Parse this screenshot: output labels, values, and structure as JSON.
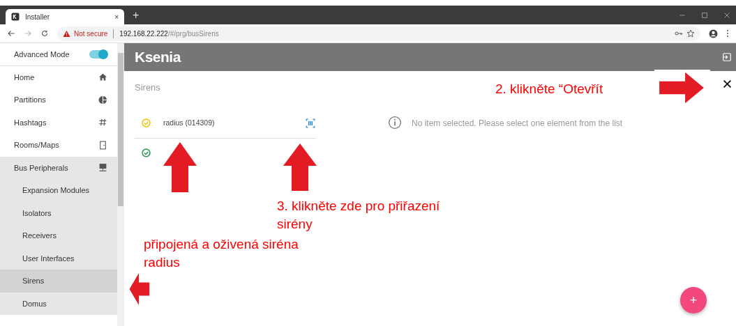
{
  "browser": {
    "tab": {
      "title": "Installer",
      "close": "×"
    },
    "new_tab": "+",
    "address": {
      "security": "Not secure",
      "host": "192.168.22.222",
      "path": "/#/prg/busSirens"
    }
  },
  "sidebar": {
    "advanced_mode": {
      "label": "Advanced Mode",
      "on": true
    },
    "items": [
      {
        "label": "Home",
        "expanded": false,
        "selected": false
      },
      {
        "label": "Partitions",
        "expanded": false,
        "selected": false
      },
      {
        "label": "Hashtags",
        "expanded": false,
        "selected": false
      },
      {
        "label": "Rooms/Maps",
        "expanded": false,
        "selected": false
      },
      {
        "label": "Bus Peripherals",
        "expanded": true,
        "selected": false,
        "children": [
          {
            "label": "Expansion Modules",
            "selected": false
          },
          {
            "label": "Isolators",
            "selected": false
          },
          {
            "label": "Receivers",
            "selected": false
          },
          {
            "label": "User Interfaces",
            "selected": false
          },
          {
            "label": "Sirens",
            "selected": true
          },
          {
            "label": "Domus",
            "selected": false
          }
        ]
      }
    ]
  },
  "header": {
    "logo": "Ksenia"
  },
  "page": {
    "title": "Sirens",
    "devices": [
      {
        "name": "radius (014309)",
        "color": "#f0c419",
        "assign": true
      },
      {
        "color": "#3a9d5d",
        "assign": false
      }
    ],
    "detail": {
      "message": "No item selected. Please select one element from the list"
    },
    "fab": "+"
  },
  "annotations": [
    {
      "kind": "note",
      "text": "2. klikněte “Otevřít"
    },
    {
      "kind": "arrow"
    },
    {
      "kind": "arrow"
    },
    {
      "kind": "arrow"
    },
    {
      "kind": "note",
      "text": "3. klikněte zde pro přiřazení sirény"
    },
    {
      "kind": "note",
      "text": "připojená a oživená siréna radius"
    },
    {
      "kind": "arrow"
    }
  ]
}
